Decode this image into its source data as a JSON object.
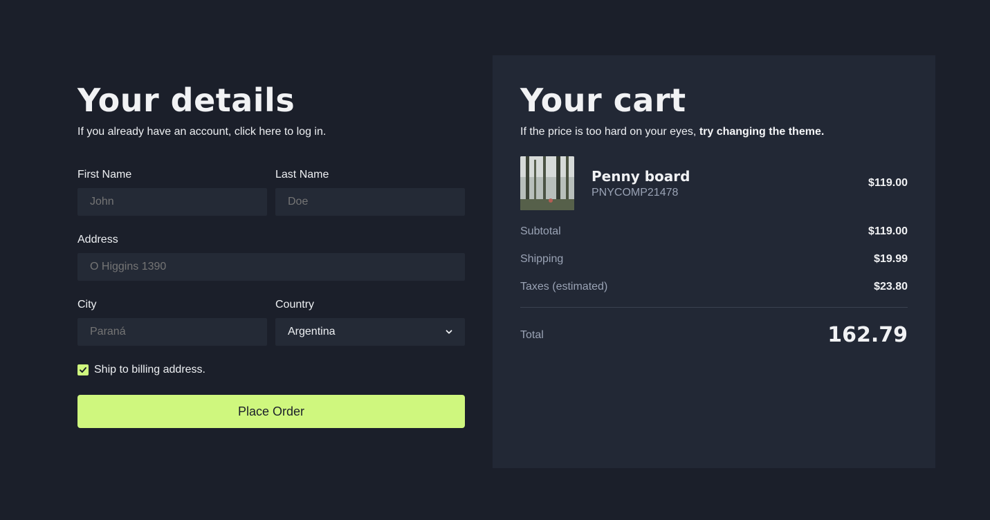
{
  "colors": {
    "background": "#1b1f2a",
    "panel": "#222835",
    "input": "#242a36",
    "accent": "#cff77e"
  },
  "details": {
    "title": "Your details",
    "subtitle": "If you already have an account, click here to log in.",
    "first_name": {
      "label": "First Name",
      "placeholder": "John"
    },
    "last_name": {
      "label": "Last Name",
      "placeholder": "Doe"
    },
    "address": {
      "label": "Address",
      "placeholder": "O Higgins 1390"
    },
    "city": {
      "label": "City",
      "placeholder": "Paraná"
    },
    "country": {
      "label": "Country",
      "value": "Argentina"
    },
    "ship_checkbox": {
      "label": "Ship to billing address.",
      "checked": true
    },
    "place_order": "Place Order"
  },
  "cart": {
    "title": "Your cart",
    "subtitle_prefix": "If the price is too hard on your eyes, ",
    "subtitle_link": "try changing the theme.",
    "item": {
      "name": "Penny board",
      "sku": "PNYCOMP21478",
      "price": "$119.00",
      "image_icon": "forest-image"
    },
    "subtotal": {
      "label": "Subtotal",
      "value": "$119.00"
    },
    "shipping": {
      "label": "Shipping",
      "value": "$19.99"
    },
    "taxes": {
      "label": "Taxes (estimated)",
      "value": "$23.80"
    },
    "total": {
      "label": "Total",
      "value": "162.79"
    }
  }
}
